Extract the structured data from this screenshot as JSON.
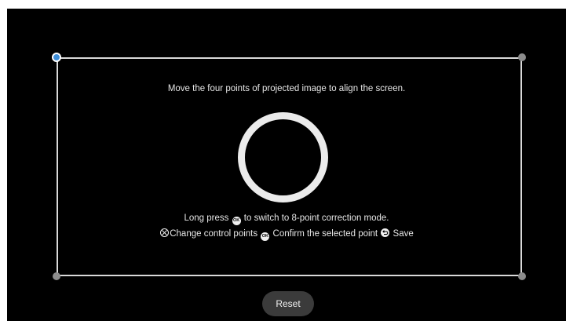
{
  "instruction": "Move the four points of projected image to align the screen.",
  "hint": {
    "long_press_prefix": "Long press",
    "ok_icon_label": "OK",
    "long_press_suffix": "to switch to 8-point correction mode."
  },
  "controls": {
    "change_label": "Change control points",
    "confirm_label": "Confirm the selected point",
    "save_label": "Save",
    "ok_icon_label": "OK"
  },
  "reset_button": "Reset",
  "corners": {
    "selected": "top-left"
  },
  "colors": {
    "background": "#000000",
    "frame": "#d9d9d9",
    "selected_corner": "#3e8ed8",
    "corner": "#8c8c8c",
    "button": "#3b3b3b"
  }
}
